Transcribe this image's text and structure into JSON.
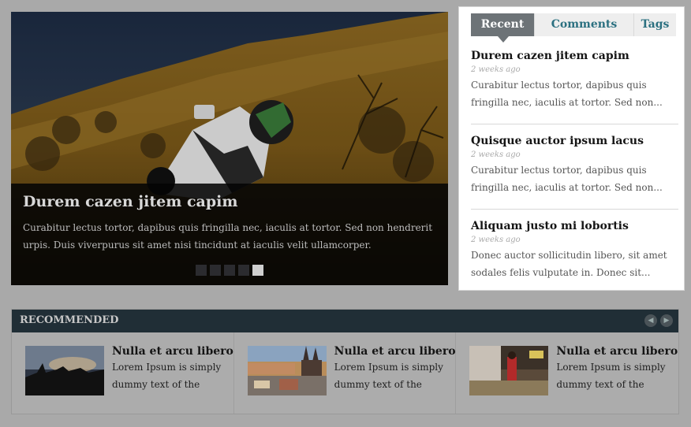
{
  "slider": {
    "title": "Durem cazen jitem capim",
    "text": "Curabitur lectus tortor, dapibus quis fringilla nec, iaculis at tortor. Sed non hendrerit urpis. Duis viverpurus sit amet nisi tincidunt at iaculis velit ullamcorper.",
    "dots": 5,
    "active_dot": 5
  },
  "tabs": {
    "recent": "Recent",
    "comments": "Comments",
    "tags": "Tags"
  },
  "posts": [
    {
      "title": "Durem cazen jitem capim",
      "date": "2 weeks ago",
      "excerpt": "Curabitur lectus tortor, dapibus quis fringilla nec, iaculis at tortor. Sed non..."
    },
    {
      "title": "Quisque auctor ipsum lacus",
      "date": "2 weeks ago",
      "excerpt": "Curabitur lectus tortor, dapibus quis fringilla nec, iaculis at tortor. Sed non..."
    },
    {
      "title": "Aliquam justo mi lobortis",
      "date": "2 weeks ago",
      "excerpt": "Donec auctor sollicitudin libero, sit amet sodales felis vulputate in. Donec sit..."
    }
  ],
  "recommended": {
    "title": "RECOMMENDED",
    "items": [
      {
        "title": "Nulla et arcu libero",
        "text": "Lorem Ipsum is simply dummy text of the"
      },
      {
        "title": "Nulla et arcu libero",
        "text": "Lorem Ipsum is simply dummy text of the"
      },
      {
        "title": "Nulla et arcu libero",
        "text": "Lorem Ipsum is simply dummy text of the"
      }
    ]
  },
  "icons": {
    "prev": "chevron-left-icon",
    "next": "chevron-right-icon"
  },
  "colors": {
    "page_bg": "#a9a9a9",
    "tab_active": "#6d7377",
    "tab_text": "#2b7080",
    "rec_bar": "#202e36"
  }
}
